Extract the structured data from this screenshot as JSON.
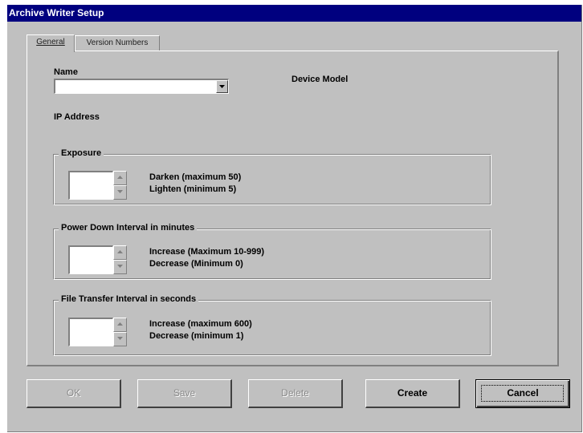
{
  "window": {
    "title": "Archive Writer Setup"
  },
  "tabs": [
    {
      "label": "General",
      "active": true
    },
    {
      "label": "Version Numbers",
      "active": false
    }
  ],
  "general": {
    "name_label": "Name",
    "name_value": "",
    "device_model_label": "Device Model",
    "ip_address_label": "IP Address"
  },
  "exposure": {
    "caption": "Exposure",
    "value": "",
    "up_hint": "Darken (maximum 50)",
    "down_hint": "Lighten (minimum 5)"
  },
  "power_down": {
    "caption": "Power Down Interval in minutes",
    "value": "",
    "up_hint": "Increase (Maximum 10-999)",
    "down_hint": "Decrease (Minimum 0)"
  },
  "file_transfer": {
    "caption": "File Transfer Interval in seconds",
    "value": "",
    "up_hint": "Increase (maximum 600)",
    "down_hint": "Decrease (minimum 1)"
  },
  "buttons": {
    "ok": "OK",
    "save": "Save",
    "delete": "Delete",
    "create": "Create",
    "cancel": "Cancel"
  },
  "icons": {
    "dropdown": "chevron-down-icon",
    "spin_up": "arrow-up-icon",
    "spin_down": "arrow-down-icon"
  },
  "colors": {
    "title_bar": "#00007f",
    "face": "#c0c0c0",
    "shadow": "#808080",
    "disabled_text": "#8a8a8a"
  }
}
